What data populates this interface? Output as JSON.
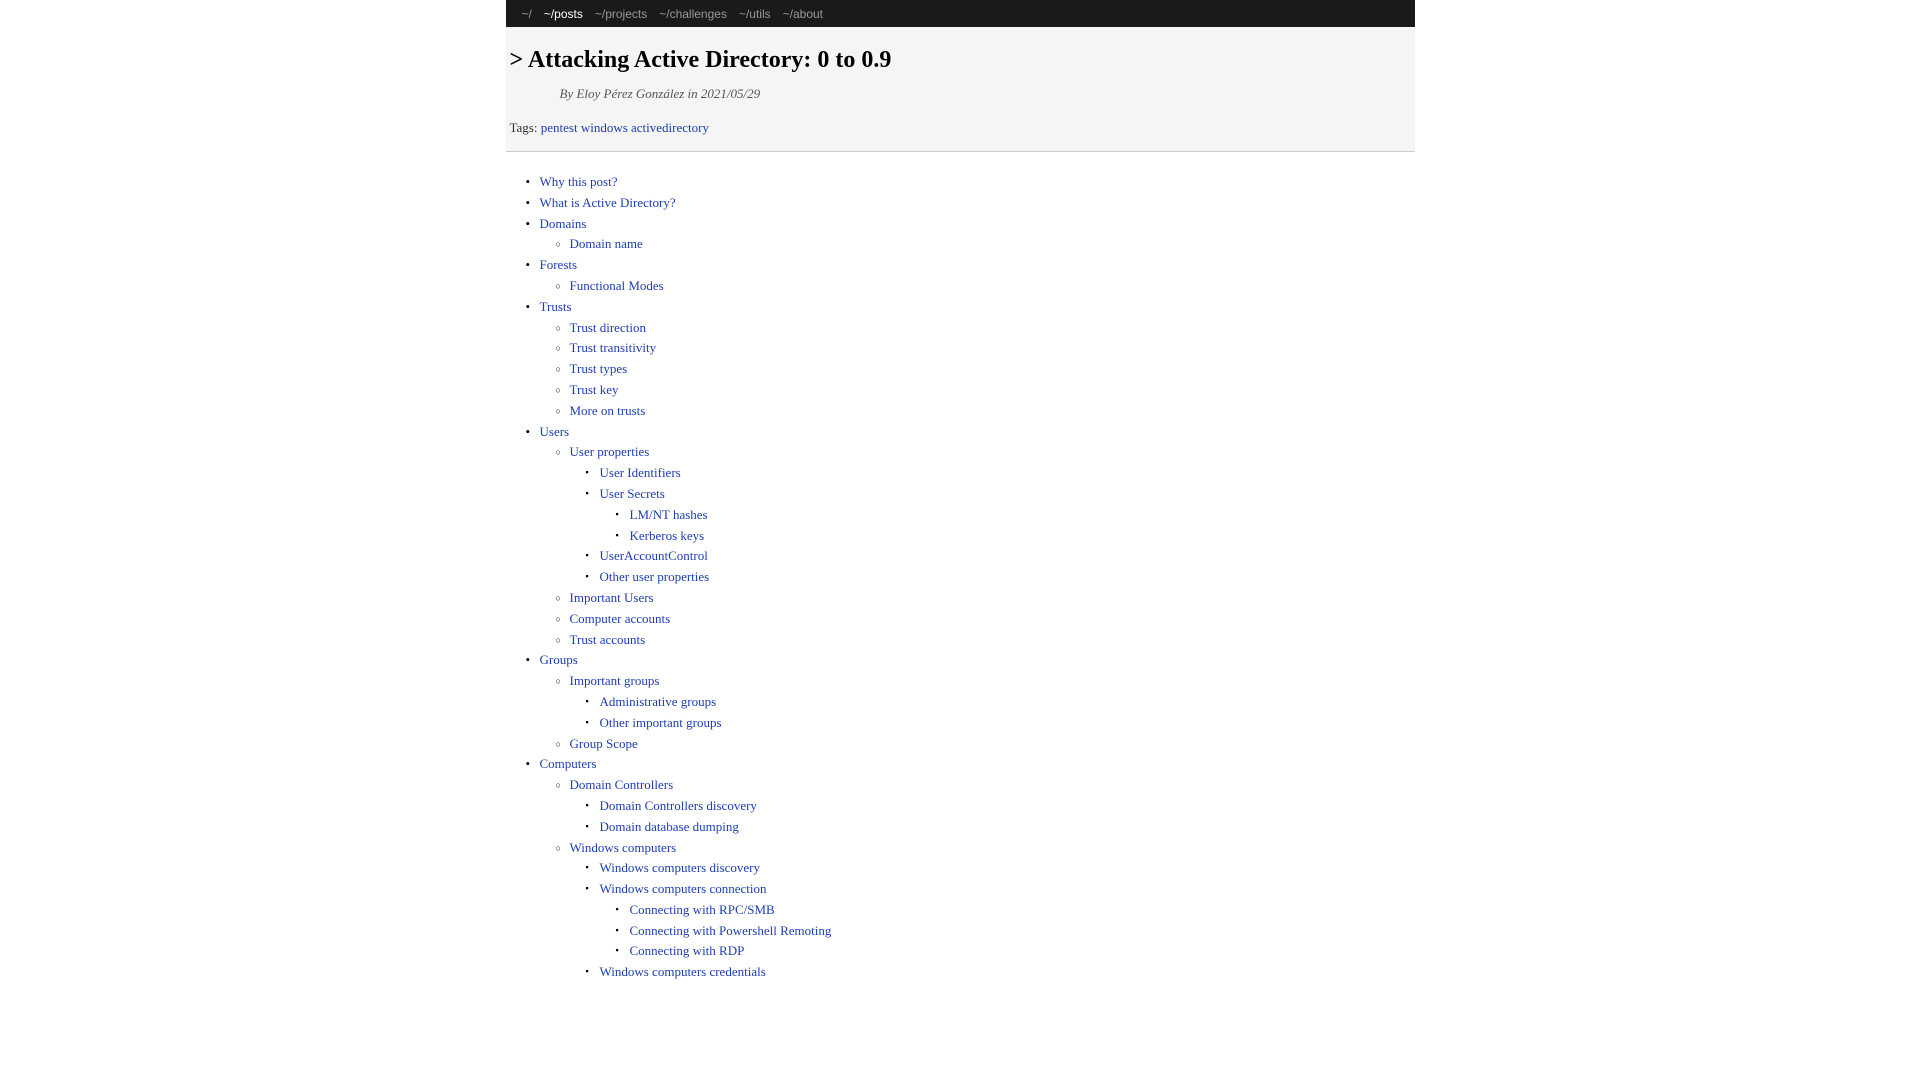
{
  "nav": {
    "items": [
      {
        "label": "~/",
        "active": false
      },
      {
        "label": "~/posts",
        "active": true
      },
      {
        "label": "~/projects",
        "active": false
      },
      {
        "label": "~/challenges",
        "active": false
      },
      {
        "label": "~/utils",
        "active": false
      },
      {
        "label": "~/about",
        "active": false
      }
    ]
  },
  "header": {
    "title_prefix": ">",
    "title": "Attacking Active Directory: 0 to 0.9",
    "byline_prefix": "By",
    "author": "Eloy Pérez González",
    "byline_mid": "in",
    "date": "2021/05/29",
    "tags_label": "Tags:",
    "tags": [
      "pentest",
      "windows",
      "activedirectory"
    ]
  },
  "toc": [
    {
      "label": "Why this post?"
    },
    {
      "label": "What is Active Directory?"
    },
    {
      "label": "Domains",
      "children": [
        {
          "label": "Domain name"
        }
      ]
    },
    {
      "label": "Forests",
      "children": [
        {
          "label": "Functional Modes"
        }
      ]
    },
    {
      "label": "Trusts",
      "children": [
        {
          "label": "Trust direction"
        },
        {
          "label": "Trust transitivity"
        },
        {
          "label": "Trust types"
        },
        {
          "label": "Trust key"
        },
        {
          "label": "More on trusts"
        }
      ]
    },
    {
      "label": "Users",
      "children": [
        {
          "label": "User properties",
          "children": [
            {
              "label": "User Identifiers"
            },
            {
              "label": "User Secrets",
              "children": [
                {
                  "label": "LM/NT hashes"
                },
                {
                  "label": "Kerberos keys"
                }
              ]
            },
            {
              "label": "UserAccountControl"
            },
            {
              "label": "Other user properties"
            }
          ]
        },
        {
          "label": "Important Users"
        },
        {
          "label": "Computer accounts"
        },
        {
          "label": "Trust accounts"
        }
      ]
    },
    {
      "label": "Groups",
      "children": [
        {
          "label": "Important groups",
          "children": [
            {
              "label": "Administrative groups"
            },
            {
              "label": "Other important groups"
            }
          ]
        },
        {
          "label": "Group Scope"
        }
      ]
    },
    {
      "label": "Computers",
      "children": [
        {
          "label": "Domain Controllers",
          "children": [
            {
              "label": "Domain Controllers discovery"
            },
            {
              "label": "Domain database dumping"
            }
          ]
        },
        {
          "label": "Windows computers",
          "children": [
            {
              "label": "Windows computers discovery"
            },
            {
              "label": "Windows computers connection",
              "children": [
                {
                  "label": "Connecting with RPC/SMB"
                },
                {
                  "label": "Connecting with Powershell Remoting"
                },
                {
                  "label": "Connecting with RDP"
                }
              ]
            },
            {
              "label": "Windows computers credentials"
            }
          ]
        }
      ]
    }
  ]
}
